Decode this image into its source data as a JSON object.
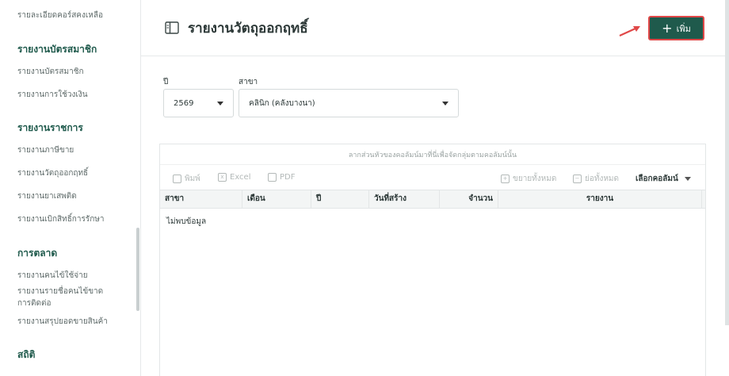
{
  "sidebar": {
    "items_top": [
      "รายละเอียดคอร์สคงเหลือ"
    ],
    "section_member": "รายงานบัตรสมาชิก",
    "member_items": [
      "รายงานบัตรสมาชิก",
      "รายงานการใช้วงเงิน"
    ],
    "section_gov": "รายงานราชการ",
    "gov_items": [
      "รายงานภาษีขาย",
      "รายงานวัตถุออกฤทธิ์",
      "รายงานยาเสพติด",
      "รายงานเบิกสิทธิ์การรักษา"
    ],
    "section_marketing": "การตลาด",
    "marketing_items": [
      "รายงานคนไข้ใช้จ่าย",
      "รายงานรายชื่อคนไข้ขาดการติดต่อ",
      "รายงานสรุปยอดขายสินค้า"
    ],
    "section_stats": "สถิติ"
  },
  "header": {
    "title": "รายงานวัตถุออกฤทธิ์",
    "add_label": "เพิ่ม",
    "title_icon": "sidebar-panel-icon",
    "arrow_color": "#e04848"
  },
  "filters": {
    "year_label": "ปี",
    "year_value": "2569",
    "branch_label": "สาขา",
    "branch_value": "คลินิก (คลังบางนา)"
  },
  "table": {
    "drag_hint": "ลากส่วนหัวของคอลัมน์มาที่นี่เพื่อจัดกลุ่มตามคอลัมน์นั้น",
    "toolbar": {
      "print": "พิมพ์",
      "excel": "Excel",
      "pdf": "PDF",
      "expand_all": "ขยายทั้งหมด",
      "collapse_all": "ย่อทั้งหมด",
      "choose_columns": "เลือกคอลัมน์"
    },
    "columns": [
      "สาขา",
      "เดือน",
      "ปี",
      "วันที่สร้าง",
      "จำนวน",
      "รายงาน"
    ],
    "empty_text": "ไม่พบข้อมูล"
  },
  "colors": {
    "primary": "#1f5a4c",
    "highlight_border": "#e04848"
  }
}
